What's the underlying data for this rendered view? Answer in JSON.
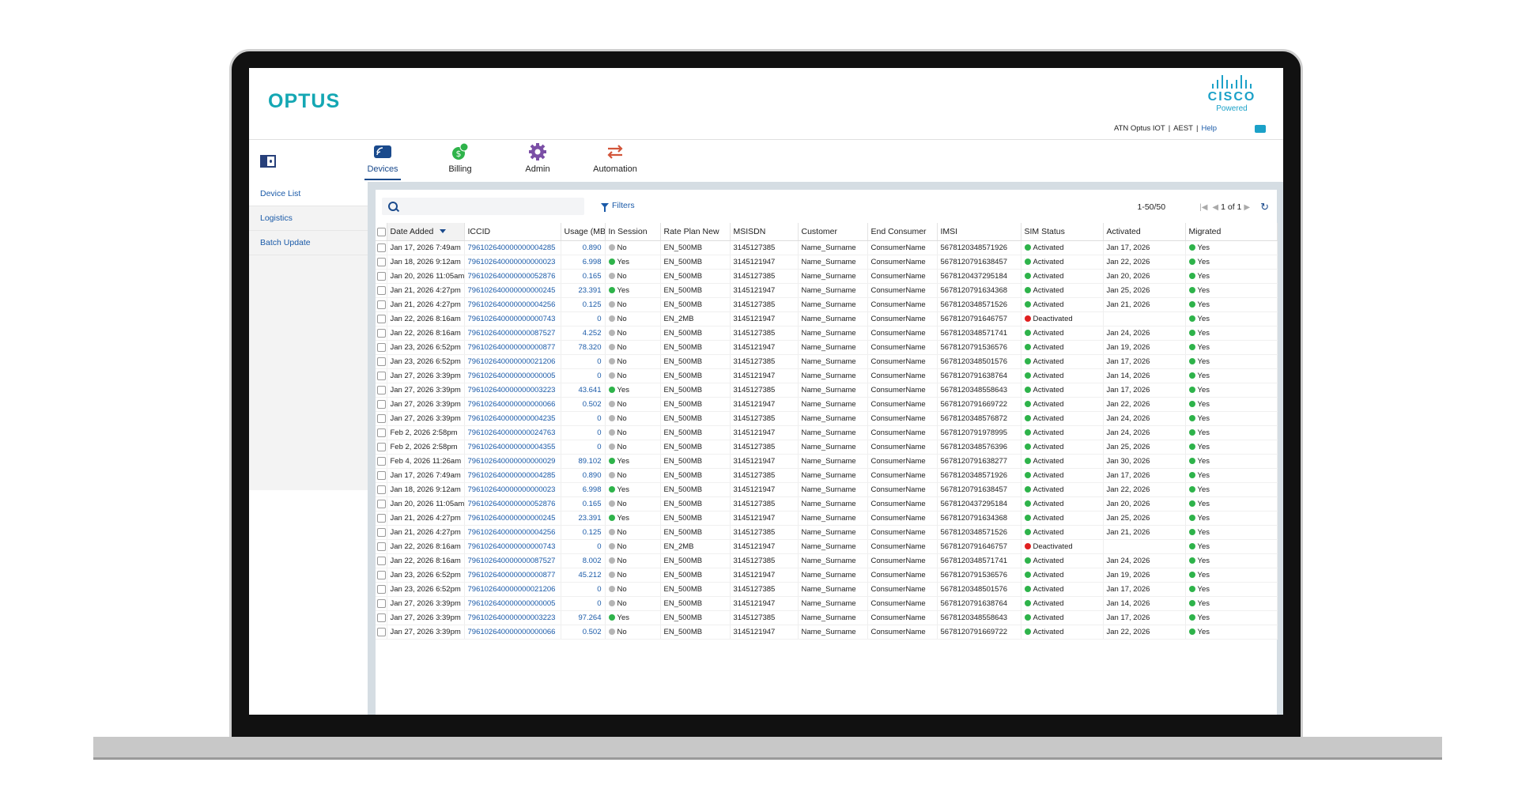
{
  "brand": {
    "logo": "OPTUS",
    "partner_word": "CISCO",
    "partner_sub": "Powered"
  },
  "account": {
    "name": "ATN Optus IOT",
    "timezone": "AEST",
    "help": "Help"
  },
  "nav": [
    {
      "label": "Devices",
      "icon": "devices-icon",
      "active": true
    },
    {
      "label": "Billing",
      "icon": "billing-icon"
    },
    {
      "label": "Admin",
      "icon": "admin-gear-icon"
    },
    {
      "label": "Automation",
      "icon": "automation-icon"
    }
  ],
  "sidebar": [
    "Device List",
    "Logistics",
    "Batch Update"
  ],
  "toolbar": {
    "search_placeholder": "",
    "filters": "Filters",
    "range": "1-50/50",
    "page": "1 of 1"
  },
  "colors": {
    "brand": "#14a7b3",
    "link": "#1a5aa8",
    "active": "#2eb34a",
    "deactivated": "#e02020"
  },
  "columns": [
    "Date Added",
    "ICCID",
    "Usage (MB",
    "In Session",
    "Rate Plan New",
    "MSISDN",
    "Customer",
    "End Consumer",
    "IMSI",
    "SIM Status",
    "Activated",
    "Migrated"
  ],
  "rows": [
    [
      "Jan 17, 2026 7:49am",
      "796102640000000004285",
      "0.890",
      "No",
      "EN_500MB",
      "3145127385",
      "Name_Surname",
      "ConsumerName",
      "5678120348571926",
      "Activated",
      "Jan 17, 2026",
      "Yes"
    ],
    [
      "Jan 18, 2026 9:12am",
      "796102640000000000023",
      "6.998",
      "Yes",
      "EN_500MB",
      "3145121947",
      "Name_Surname",
      "ConsumerName",
      "5678120791638457",
      "Activated",
      "Jan 22, 2026",
      "Yes"
    ],
    [
      "Jan 20, 2026 11:05am",
      "796102640000000052876",
      "0.165",
      "No",
      "EN_500MB",
      "3145127385",
      "Name_Surname",
      "ConsumerName",
      "5678120437295184",
      "Activated",
      "Jan 20, 2026",
      "Yes"
    ],
    [
      "Jan 21, 2026 4:27pm",
      "796102640000000000245",
      "23.391",
      "Yes",
      "EN_500MB",
      "3145121947",
      "Name_Surname",
      "ConsumerName",
      "5678120791634368",
      "Activated",
      "Jan 25, 2026",
      "Yes"
    ],
    [
      "Jan 21, 2026 4:27pm",
      "796102640000000004256",
      "0.125",
      "No",
      "EN_500MB",
      "3145127385",
      "Name_Surname",
      "ConsumerName",
      "5678120348571526",
      "Activated",
      "Jan 21, 2026",
      "Yes"
    ],
    [
      "Jan 22, 2026 8:16am",
      "796102640000000000743",
      "0",
      "No",
      "EN_2MB",
      "3145121947",
      "Name_Surname",
      "ConsumerName",
      "5678120791646757",
      "Deactivated",
      "",
      "Yes"
    ],
    [
      "Jan 22, 2026 8:16am",
      "796102640000000087527",
      "4.252",
      "No",
      "EN_500MB",
      "3145127385",
      "Name_Surname",
      "ConsumerName",
      "5678120348571741",
      "Activated",
      "Jan 24, 2026",
      "Yes"
    ],
    [
      "Jan 23, 2026 6:52pm",
      "796102640000000000877",
      "78.320",
      "No",
      "EN_500MB",
      "3145121947",
      "Name_Surname",
      "ConsumerName",
      "5678120791536576",
      "Activated",
      "Jan 19, 2026",
      "Yes"
    ],
    [
      "Jan 23, 2026 6:52pm",
      "796102640000000021206",
      "0",
      "No",
      "EN_500MB",
      "3145127385",
      "Name_Surname",
      "ConsumerName",
      "5678120348501576",
      "Activated",
      "Jan 17, 2026",
      "Yes"
    ],
    [
      "Jan 27, 2026 3:39pm",
      "796102640000000000005",
      "0",
      "No",
      "EN_500MB",
      "3145121947",
      "Name_Surname",
      "ConsumerName",
      "5678120791638764",
      "Activated",
      "Jan 14, 2026",
      "Yes"
    ],
    [
      "Jan 27, 2026 3:39pm",
      "796102640000000003223",
      "43.641",
      "Yes",
      "EN_500MB",
      "3145127385",
      "Name_Surname",
      "ConsumerName",
      "5678120348558643",
      "Activated",
      "Jan 17, 2026",
      "Yes"
    ],
    [
      "Jan 27, 2026 3:39pm",
      "796102640000000000066",
      "0.502",
      "No",
      "EN_500MB",
      "3145121947",
      "Name_Surname",
      "ConsumerName",
      "5678120791669722",
      "Activated",
      "Jan 22, 2026",
      "Yes"
    ],
    [
      "Jan 27, 2026 3:39pm",
      "796102640000000004235",
      "0",
      "No",
      "EN_500MB",
      "3145127385",
      "Name_Surname",
      "ConsumerName",
      "5678120348576872",
      "Activated",
      "Jan 24, 2026",
      "Yes"
    ],
    [
      "Feb 2, 2026 2:58pm",
      "796102640000000024763",
      "0",
      "No",
      "EN_500MB",
      "3145121947",
      "Name_Surname",
      "ConsumerName",
      "5678120791978995",
      "Activated",
      "Jan 24, 2026",
      "Yes"
    ],
    [
      "Feb 2, 2026 2:58pm",
      "796102640000000004355",
      "0",
      "No",
      "EN_500MB",
      "3145127385",
      "Name_Surname",
      "ConsumerName",
      "5678120348576396",
      "Activated",
      "Jan 25, 2026",
      "Yes"
    ],
    [
      "Feb 4, 2026 11:26am",
      "796102640000000000029",
      "89.102",
      "Yes",
      "EN_500MB",
      "3145121947",
      "Name_Surname",
      "ConsumerName",
      "5678120791638277",
      "Activated",
      "Jan 30, 2026",
      "Yes"
    ],
    [
      "Jan 17, 2026 7:49am",
      "796102640000000004285",
      "0.890",
      "No",
      "EN_500MB",
      "3145127385",
      "Name_Surname",
      "ConsumerName",
      "5678120348571926",
      "Activated",
      "Jan 17, 2026",
      "Yes"
    ],
    [
      "Jan 18, 2026 9:12am",
      "796102640000000000023",
      "6.998",
      "Yes",
      "EN_500MB",
      "3145121947",
      "Name_Surname",
      "ConsumerName",
      "5678120791638457",
      "Activated",
      "Jan 22, 2026",
      "Yes"
    ],
    [
      "Jan 20, 2026 11:05am",
      "796102640000000052876",
      "0.165",
      "No",
      "EN_500MB",
      "3145127385",
      "Name_Surname",
      "ConsumerName",
      "5678120437295184",
      "Activated",
      "Jan 20, 2026",
      "Yes"
    ],
    [
      "Jan 21, 2026 4:27pm",
      "796102640000000000245",
      "23.391",
      "Yes",
      "EN_500MB",
      "3145121947",
      "Name_Surname",
      "ConsumerName",
      "5678120791634368",
      "Activated",
      "Jan 25, 2026",
      "Yes"
    ],
    [
      "Jan 21, 2026 4:27pm",
      "796102640000000004256",
      "0.125",
      "No",
      "EN_500MB",
      "3145127385",
      "Name_Surname",
      "ConsumerName",
      "5678120348571526",
      "Activated",
      "Jan 21, 2026",
      "Yes"
    ],
    [
      "Jan 22, 2026 8:16am",
      "796102640000000000743",
      "0",
      "No",
      "EN_2MB",
      "3145121947",
      "Name_Surname",
      "ConsumerName",
      "5678120791646757",
      "Deactivated",
      "",
      "Yes"
    ],
    [
      "Jan 22, 2026 8:16am",
      "796102640000000087527",
      "8.002",
      "No",
      "EN_500MB",
      "3145127385",
      "Name_Surname",
      "ConsumerName",
      "5678120348571741",
      "Activated",
      "Jan 24, 2026",
      "Yes"
    ],
    [
      "Jan 23, 2026 6:52pm",
      "796102640000000000877",
      "45.212",
      "No",
      "EN_500MB",
      "3145121947",
      "Name_Surname",
      "ConsumerName",
      "5678120791536576",
      "Activated",
      "Jan 19, 2026",
      "Yes"
    ],
    [
      "Jan 23, 2026 6:52pm",
      "796102640000000021206",
      "0",
      "No",
      "EN_500MB",
      "3145127385",
      "Name_Surname",
      "ConsumerName",
      "5678120348501576",
      "Activated",
      "Jan 17, 2026",
      "Yes"
    ],
    [
      "Jan 27, 2026 3:39pm",
      "796102640000000000005",
      "0",
      "No",
      "EN_500MB",
      "3145121947",
      "Name_Surname",
      "ConsumerName",
      "5678120791638764",
      "Activated",
      "Jan 14, 2026",
      "Yes"
    ],
    [
      "Jan 27, 2026 3:39pm",
      "796102640000000003223",
      "97.264",
      "Yes",
      "EN_500MB",
      "3145127385",
      "Name_Surname",
      "ConsumerName",
      "5678120348558643",
      "Activated",
      "Jan 17, 2026",
      "Yes"
    ],
    [
      "Jan 27, 2026 3:39pm",
      "796102640000000000066",
      "0.502",
      "No",
      "EN_500MB",
      "3145121947",
      "Name_Surname",
      "ConsumerName",
      "5678120791669722",
      "Activated",
      "Jan 22, 2026",
      "Yes"
    ]
  ]
}
